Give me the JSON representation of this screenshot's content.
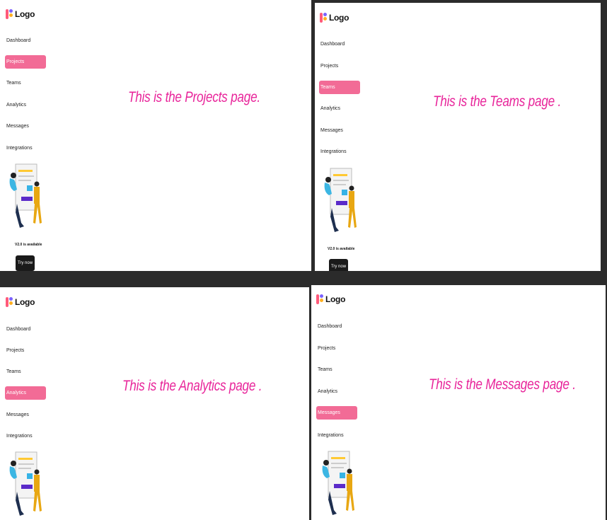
{
  "logo": {
    "text": "Logo"
  },
  "nav": {
    "dashboard": "Dashboard",
    "projects": "Projects",
    "teams": "Teams",
    "analytics": "Analytics",
    "messages": "Messages",
    "integrations": "Integrations"
  },
  "promo": {
    "text": "V2.0 is available",
    "button": "Try now"
  },
  "pages": {
    "projects": "This is the Projects page.",
    "teams": "This is the Teams page .",
    "analytics": "This is the Analytics page .",
    "messages": "This is the Messages page ."
  },
  "colors": {
    "accent": "#f26b96",
    "page_text": "#e8249a",
    "background": "#2b2b2b"
  },
  "icons": [
    "logo-mark-icon"
  ]
}
